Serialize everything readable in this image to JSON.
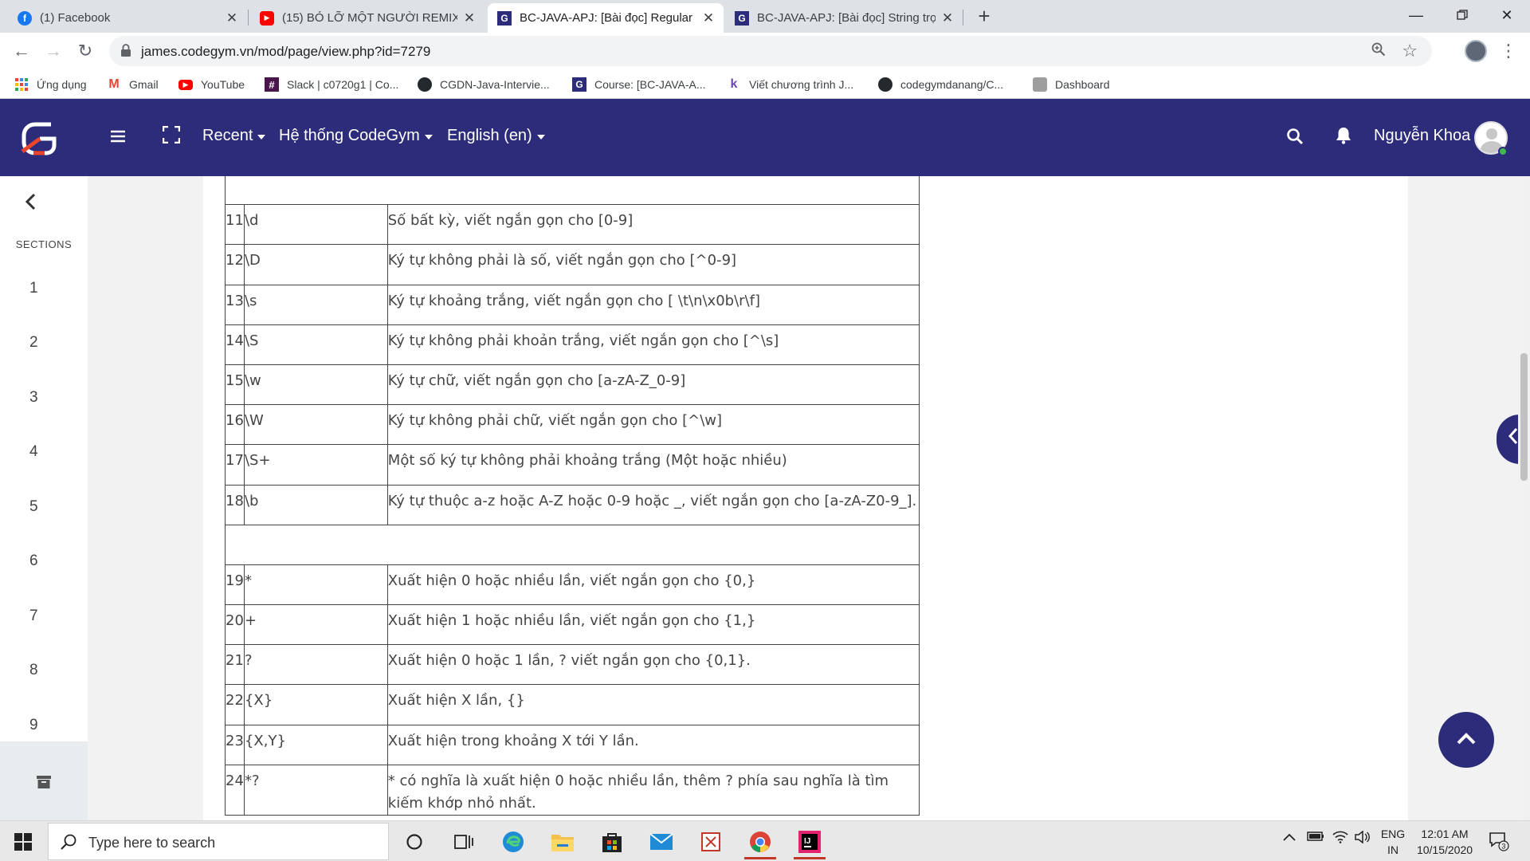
{
  "browser": {
    "tabs": [
      {
        "label": "(1) Facebook",
        "icon": "facebook-icon",
        "active": false
      },
      {
        "label": "(15) BỎ LỠ MỘT NGƯỜI REMIX",
        "icon": "youtube-icon",
        "active": false
      },
      {
        "label": "BC-JAVA-APJ: [Bài đọc] Regular E",
        "icon": "codegym-icon",
        "active": true
      },
      {
        "label": "BC-JAVA-APJ: [Bài đọc] String trọ",
        "icon": "codegym-icon",
        "active": false
      }
    ],
    "new_tab": "+",
    "url": "james.codegym.vn/mod/page/view.php?id=7279",
    "bookmarks": [
      {
        "label": "Ứng dụng",
        "icon": "apps-grid-icon"
      },
      {
        "label": "Gmail",
        "icon": "gmail-icon"
      },
      {
        "label": "YouTube",
        "icon": "youtube-icon"
      },
      {
        "label": "Slack | c0720g1 | Co...",
        "icon": "slack-icon"
      },
      {
        "label": "CGDN-Java-Intervie...",
        "icon": "github-icon"
      },
      {
        "label": "Course: [BC-JAVA-A...",
        "icon": "codegym-icon"
      },
      {
        "label": "Viết chương trình J...",
        "icon": "k-icon"
      },
      {
        "label": "codegymdanang/C...",
        "icon": "github-icon"
      },
      {
        "label": "Dashboard",
        "icon": "dashboard-icon"
      }
    ]
  },
  "navbar": {
    "menus": [
      {
        "label": "Recent"
      },
      {
        "label": "Hệ thống CodeGym"
      },
      {
        "label": "English (en)"
      }
    ],
    "user_name": "Nguyễn Khoa",
    "colors": {
      "primary": "#2c2c7b",
      "logo_accent": "#e8452c"
    }
  },
  "drawer": {
    "sections_label": "SECTIONS",
    "sections": [
      "1",
      "2",
      "3",
      "4",
      "5",
      "6",
      "7",
      "8",
      "9"
    ]
  },
  "table": {
    "rows": [
      {
        "type": "blank"
      },
      {
        "num": "11",
        "pattern": "\\d",
        "desc": "Số bất kỳ, viết ngắn gọn cho [0-9]"
      },
      {
        "num": "12",
        "pattern": "\\D",
        "desc": "Ký tự không phải là số, viết ngắn gọn cho [^0-9]"
      },
      {
        "num": "13",
        "pattern": "\\s",
        "desc": "Ký tự khoảng trắng, viết ngắn gọn cho [ \\t\\n\\x0b\\r\\f]"
      },
      {
        "num": "14",
        "pattern": "\\S",
        "desc": "Ký tự không phải khoản trắng, viết ngắn gọn cho [^\\s]"
      },
      {
        "num": "15",
        "pattern": "\\w",
        "desc": "Ký tự chữ, viết ngắn gọn cho [a-zA-Z_0-9]"
      },
      {
        "num": "16",
        "pattern": "\\W",
        "desc": "Ký tự không phải chữ, viết ngắn gọn cho [^\\w]"
      },
      {
        "num": "17",
        "pattern": "\\S+",
        "desc": "Một số ký tự không phải khoảng trắng (Một hoặc nhiều)"
      },
      {
        "num": "18",
        "pattern": "\\b",
        "desc": "Ký tự thuộc a-z hoặc A-Z hoặc 0-9 hoặc _, viết ngắn gọn cho [a-zA-Z0-9_]."
      },
      {
        "type": "blank"
      },
      {
        "num": "19",
        "pattern": "*",
        "desc": "Xuất hiện 0 hoặc nhiều lần, viết ngắn gọn cho {0,}"
      },
      {
        "num": "20",
        "pattern": "+",
        "desc": "Xuất hiện 1 hoặc nhiều lần, viết ngắn gọn cho {1,}"
      },
      {
        "num": "21",
        "pattern": "?",
        "desc": "Xuất hiện 0 hoặc 1 lần, ? viết ngắn gọn cho {0,1}."
      },
      {
        "num": "22",
        "pattern": "{X}",
        "desc": "Xuất hiện X lần, {}"
      },
      {
        "num": "23",
        "pattern": "{X,Y}",
        "desc": "Xuất hiện trong khoảng X tới Y lần."
      },
      {
        "num": "24",
        "pattern": "*?",
        "desc": "* có nghĩa là xuất hiện 0 hoặc nhiều lần, thêm ? phía sau nghĩa là tìm kiếm khớp nhỏ nhất."
      }
    ]
  },
  "taskbar": {
    "search_placeholder": "Type here to search",
    "lang_top": "ENG",
    "lang_bottom": "IN",
    "time": "12:01 AM",
    "date": "10/15/2020",
    "notification_count": "3"
  }
}
